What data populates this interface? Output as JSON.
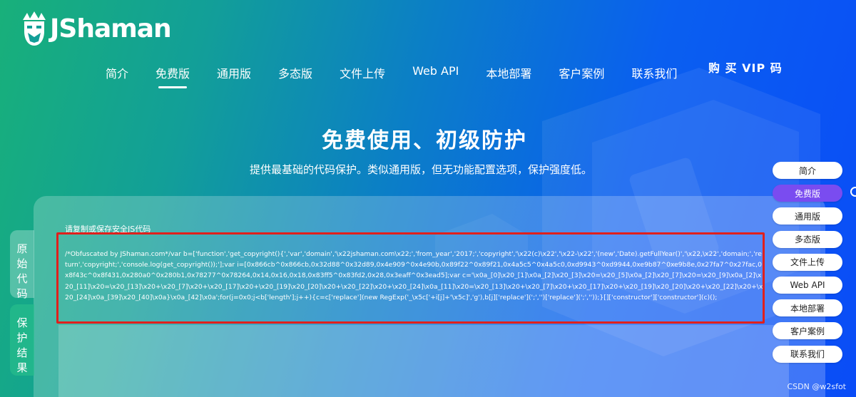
{
  "logo": {
    "text": "JShaman",
    "icon": "king-face-icon"
  },
  "nav": {
    "items": [
      "简介",
      "免费版",
      "通用版",
      "多态版",
      "文件上传",
      "Web API",
      "本地部署",
      "客户案例",
      "联系我们"
    ],
    "active_index": 1,
    "vip_label": "购 买 VIP 码"
  },
  "hero": {
    "title": "免费使用、初级防护",
    "subtitle": "提供最基础的代码保护。类似通用版，但无功能配置选项，保护强度低。"
  },
  "side_tabs": [
    "原始代码",
    "保护结果"
  ],
  "code": {
    "label": "请复制或保存安全JS代码",
    "content": "/*Obfuscated by JShaman.com*/var b=['function','get_copyright(){','var','domain','\\x22jshaman.com\\x22;','from_year','2017;','copyright','\\x22(c)\\x22','\\x22-\\x22','(new','Date).getFullYear()','\\x22,\\x22','domain;','return','copyright;','console.log(get_copyright());'];var i=[0x866cb^0x866cb,0x32d88^0x32d89,0x4e909^0x4e90b,0x89f22^0x89f21,0x4a5c5^0x4a5c0,0xd9943^0xd9944,0xe9b87^0xe9b8e,0x27fa7^0x27fac,0x8f43c^0x8f431,0x280a0^0x280b1,0x78277^0x78264,0x14,0x16,0x18,0x83ff5^0x83fd2,0x28,0x3eaff^0x3ead5];var c='\\x0a_[0]\\x20_[1]\\x0a_[2]\\x20_[3]\\x20=\\x20_[5]\\x0a_[2]\\x20_[7]\\x20=\\x20_[9]\\x0a_[2]\\x20_[11]\\x20=\\x20_[13]\\x20+\\x20_[7]\\x20+\\x20_[17]\\x20+\\x20_[19]\\x20_[20]\\x20+\\x20_[22]\\x20+\\x20_[24]\\x0a_[11]\\x20=\\x20_[13]\\x20+\\x20_[7]\\x20+\\x20_[17]\\x20+\\x20_[19]\\x20_[20]\\x20+\\x20_[22]\\x20+\\x20_[24]\\x0a_[39]\\x20_[40]\\x0a}\\x0a_[42]\\x0a';for(j=0x0;j<b['length'];j++){c=c['replace'](new RegExp('_\\x5c['+i[j]+'\\x5c]','g'),b[j]['replace'](';','')['replace'](';',''));}[]['constructor']['constructor'](c)();"
  },
  "right_nav": {
    "items": [
      "简介",
      "免费版",
      "通用版",
      "多态版",
      "文件上传",
      "Web API",
      "本地部署",
      "客户案例",
      "联系我们"
    ],
    "active_index": 1
  },
  "watermark": "CSDN @w2sfot"
}
